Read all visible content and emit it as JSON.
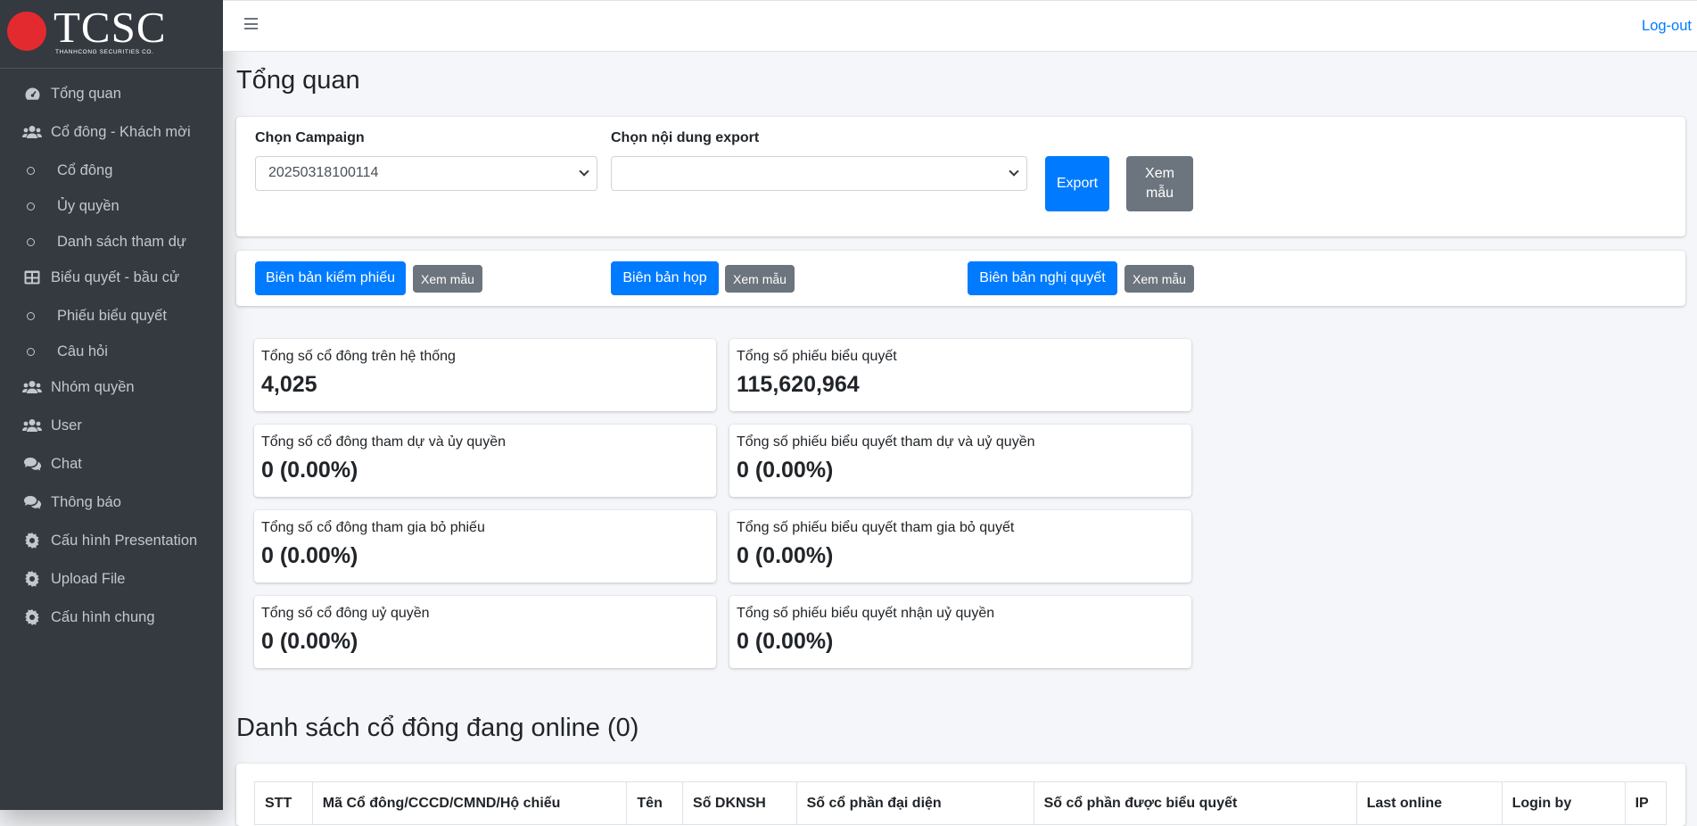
{
  "brand": {
    "name": "TCSC",
    "subtitle": "THANHCONG SECURITIES CO."
  },
  "sidebar": {
    "items": [
      {
        "label": "Tổng quan",
        "icon": "dashboard-icon"
      },
      {
        "label": "Cổ đông - Khách mời",
        "icon": "users-icon"
      },
      {
        "label": "Cổ đông",
        "icon": "circle-icon"
      },
      {
        "label": "Ủy quyền",
        "icon": "circle-icon"
      },
      {
        "label": "Danh sách tham dự",
        "icon": "circle-icon"
      },
      {
        "label": "Biểu quyết - bầu cử",
        "icon": "table-icon"
      },
      {
        "label": "Phiếu biểu quyết",
        "icon": "circle-icon"
      },
      {
        "label": "Câu hỏi",
        "icon": "circle-icon"
      },
      {
        "label": "Nhóm quyền",
        "icon": "users-icon"
      },
      {
        "label": "User",
        "icon": "users-icon"
      },
      {
        "label": "Chat",
        "icon": "comments-icon"
      },
      {
        "label": "Thông báo",
        "icon": "comments-icon"
      },
      {
        "label": "Cấu hình Presentation",
        "icon": "gear-icon"
      },
      {
        "label": "Upload File",
        "icon": "gear-icon"
      },
      {
        "label": "Cấu hình chung",
        "icon": "gear-icon"
      }
    ]
  },
  "topbar": {
    "logout_label": "Log-out"
  },
  "page": {
    "title": "Tổng quan"
  },
  "export_panel": {
    "campaign_label": "Chọn Campaign",
    "campaign_value": "20250318100114",
    "content_label": "Chọn nội dung export",
    "content_value": "",
    "export_button": "Export",
    "preview_button": "Xem mẫu"
  },
  "reports": [
    {
      "label": "Biên bản kiểm phiếu",
      "preview": "Xem mẫu"
    },
    {
      "label": "Biên bản họp",
      "preview": "Xem mẫu"
    },
    {
      "label": "Biên bản nghị quyết",
      "preview": "Xem mẫu"
    }
  ],
  "stats": [
    {
      "label": "Tổng số cổ đông trên hệ thống",
      "value": "4,025"
    },
    {
      "label": "Tổng số phiếu biểu quyết",
      "value": "115,620,964"
    },
    {
      "label": "Tổng số cổ đông tham dự và ủy quyền",
      "value": "0 (0.00%)"
    },
    {
      "label": "Tổng số phiếu biểu quyết tham dự và uỷ quyền",
      "value": "0 (0.00%)"
    },
    {
      "label": "Tổng số cổ đông tham gia bỏ phiếu",
      "value": "0 (0.00%)"
    },
    {
      "label": "Tổng số phiếu biểu quyết tham gia bỏ quyết",
      "value": "0 (0.00%)"
    },
    {
      "label": "Tổng số cổ đông uỷ quyền",
      "value": "0 (0.00%)"
    },
    {
      "label": "Tổng số phiếu biểu quyết nhận uỷ quyền",
      "value": "0 (0.00%)"
    }
  ],
  "online_section": {
    "title": "Danh sách cổ đông đang online (0)",
    "columns": [
      "STT",
      "Mã Cổ đông/CCCD/CMND/Hộ chiếu",
      "Tên",
      "Số DKNSH",
      "Số cổ phần đại diện",
      "Số cổ phần được biểu quyết",
      "Last online",
      "Login by",
      "IP"
    ]
  },
  "colors": {
    "sidebar_bg": "#343a40",
    "primary": "#007bff",
    "secondary": "#6c757d",
    "brand_red": "#e32a2f"
  }
}
